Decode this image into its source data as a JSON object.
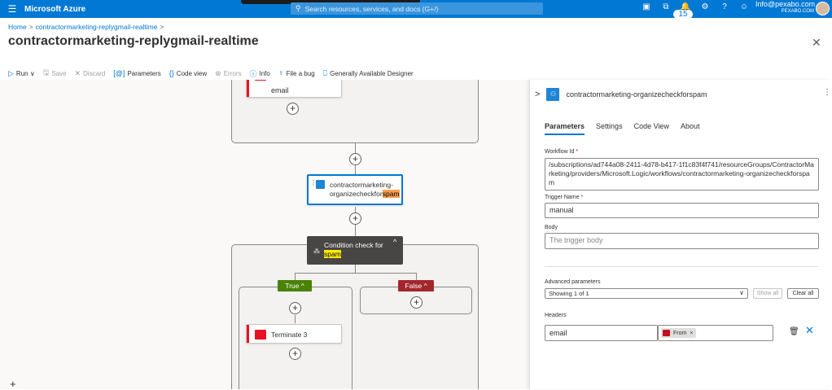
{
  "topbar": {
    "brand": "Microsoft Azure",
    "search_placeholder": "Search resources, services, and docs (G+/)",
    "notification_count": "15",
    "user_email": "Info@pexabo.com",
    "user_org": "PEXABO.COM"
  },
  "breadcrumb": {
    "home": "Home",
    "parent": "contractormarketing-replygmail-realtime"
  },
  "page": {
    "title": "contractormarketing-replygmail-realtime",
    "more": "···"
  },
  "toolbar": {
    "run": "Run",
    "save": "Save",
    "discard": "Discard",
    "parameters": "Parameters",
    "code_view": "Code view",
    "errors": "Errors",
    "info": "Info",
    "file_bug": "File a bug",
    "designer": "Generally Available Designer"
  },
  "canvas": {
    "top_card_text": "email",
    "action_line1": "contractormarketing-",
    "action_line2_prefix": "organizecheckfor",
    "action_line2_highlight": "spam",
    "condition_line1": "Condition check for",
    "condition_highlight": "spam",
    "true_label": "True",
    "false_label": "False",
    "terminate_label": "Terminate 3"
  },
  "panel": {
    "title": "contractormarketing-organizecheckforspam",
    "tabs": [
      "Parameters",
      "Settings",
      "Code View",
      "About"
    ],
    "workflow_id_label": "Workflow Id",
    "workflow_id_value": "/subscriptions/ad744a08-2411-4d78-b417-1f1c83f4f741/resourceGroups/ContractorMarketing/providers/Microsoft.Logic/workflows/contractormarketing-organizecheckforspam",
    "trigger_name_label": "Trigger Name",
    "trigger_name_value": "manual",
    "body_label": "Body",
    "body_placeholder": "The trigger body",
    "advanced_label": "Advanced parameters",
    "advanced_select": "Showing 1 of 1",
    "show_all": "Show all",
    "clear_all": "Clear all",
    "headers_label": "Headers",
    "header_key": "email",
    "header_token": "From"
  },
  "colors": {
    "accent": "#0078d4",
    "true_green": "#498205",
    "false_red": "#a4262c",
    "terminate_red": "#e81123"
  }
}
